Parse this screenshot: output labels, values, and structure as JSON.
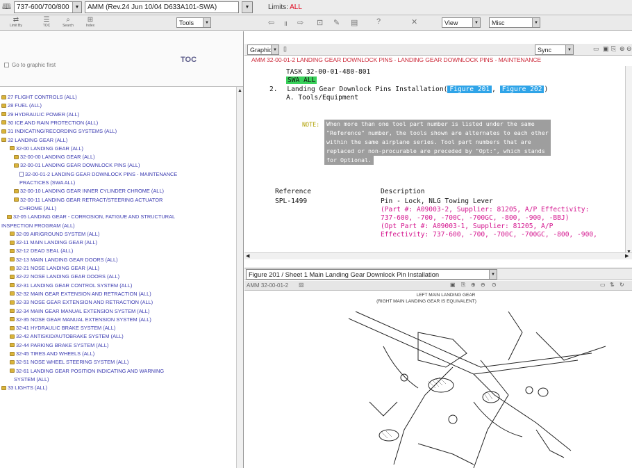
{
  "top_bar": {
    "model_select": "737-600/700/800",
    "manual_select": "AMM  (Rev.24  Jun 10/04  D633A101-SWA)",
    "limits_label": "Limits:",
    "limits_value": "ALL"
  },
  "toolbar": {
    "buttons": [
      {
        "icon": "limit-by-icon",
        "label": "Limit By"
      },
      {
        "icon": "toc-list-icon",
        "label": "TOC"
      },
      {
        "icon": "search-binoculars-icon",
        "label": "Search"
      },
      {
        "icon": "index-icon",
        "label": "Index"
      }
    ],
    "tools_select": "Tools",
    "view_select": "View",
    "misc_select": "Misc"
  },
  "toc": {
    "goto_graphic_label": "Go to graphic first",
    "title": "TOC",
    "items": [
      {
        "icon": "folder",
        "text": "27 FLIGHT CONTROLS  (ALL)"
      },
      {
        "icon": "folder",
        "text": "28 FUEL  (ALL)"
      },
      {
        "icon": "folder",
        "text": "29 HYDRAULIC POWER  (ALL)"
      },
      {
        "icon": "folder",
        "text": "30 ICE AND RAIN PROTECTION  (ALL)"
      },
      {
        "icon": "folder",
        "text": "31 INDICATING/RECORDING SYSTEMS  (ALL)"
      },
      {
        "icon": "folder-open",
        "text": "32 LANDING GEAR  (ALL)"
      },
      {
        "icon": "folder-open",
        "text": "32-00 LANDING GEAR  (ALL)"
      },
      {
        "icon": "folder",
        "text": "32-00-00 LANDING GEAR  (ALL)"
      },
      {
        "icon": "folder-open",
        "text": "32-00-01 LANDING GEAR DOWNLOCK PINS  (ALL)"
      },
      {
        "icon": "doc",
        "text": "32-00-01-2 LANDING GEAR DOWNLOCK PINS - MAINTENANCE"
      },
      {
        "icon": "none",
        "text": "PRACTICES  (SWA ALL)"
      },
      {
        "icon": "folder",
        "text": "32-00-10 LANDING GEAR INNER CYLINDER CHROME  (ALL)"
      },
      {
        "icon": "folder",
        "text": "32-00-11 LANDING GEAR RETRACT/STEERING ACTUATOR"
      },
      {
        "icon": "none",
        "text": "CHROME  (ALL)"
      },
      {
        "icon": "folder",
        "text": "32-05 LANDING GEAR - CORROSION, FATIGUE AND STRUCTURAL"
      },
      {
        "icon": "none",
        "text": "INSPECTION PROGRAM  (ALL)"
      },
      {
        "icon": "folder",
        "text": "32-09 AIR/GROUND SYSTEM  (ALL)"
      },
      {
        "icon": "folder",
        "text": "32-11 MAIN LANDING GEAR  (ALL)"
      },
      {
        "icon": "folder",
        "text": "32-12 DEAD SEAL  (ALL)"
      },
      {
        "icon": "folder",
        "text": "32-13 MAIN LANDING GEAR DOORS  (ALL)"
      },
      {
        "icon": "folder",
        "text": "32-21 NOSE LANDING GEAR  (ALL)"
      },
      {
        "icon": "folder",
        "text": "32-22 NOSE LANDING GEAR DOORS  (ALL)"
      },
      {
        "icon": "folder",
        "text": "32-31 LANDING GEAR CONTROL SYSTEM  (ALL)"
      },
      {
        "icon": "folder",
        "text": "32-32 MAIN GEAR EXTENSION AND RETRACTION  (ALL)"
      },
      {
        "icon": "folder",
        "text": "32-33 NOSE GEAR EXTENSION AND RETRACTION  (ALL)"
      },
      {
        "icon": "folder",
        "text": "32-34 MAIN GEAR MANUAL EXTENSION SYSTEM  (ALL)"
      },
      {
        "icon": "folder",
        "text": "32-35 NOSE GEAR MANUAL EXTENSION SYSTEM  (ALL)"
      },
      {
        "icon": "folder",
        "text": "32-41 HYDRAULIC BRAKE SYSTEM  (ALL)"
      },
      {
        "icon": "folder",
        "text": "32-42 ANTISKID/AUTOBRAKE SYSTEM  (ALL)"
      },
      {
        "icon": "folder",
        "text": "32-44 PARKING BRAKE SYSTEM  (ALL)"
      },
      {
        "icon": "folder",
        "text": "32-45 TIRES AND WHEELS  (ALL)"
      },
      {
        "icon": "folder",
        "text": "32-51 NOSE WHEEL STEERING SYSTEM  (ALL)"
      },
      {
        "icon": "folder",
        "text": "32-61 LANDING GEAR POSITION INDICATING AND WARNING"
      },
      {
        "icon": "none",
        "text": "SYSTEM  (ALL)"
      },
      {
        "icon": "folder",
        "text": "33 LIGHTS  (ALL)"
      }
    ]
  },
  "graphics_bar": {
    "graphics_select": "Graphics",
    "sync_select": "Sync"
  },
  "document": {
    "title_strip": "AMM 32-00-01-2 LANDING GEAR DOWNLOCK PINS - LANDING GEAR DOWNLOCK PINS - MAINTENANCE",
    "task": "TASK 32-00-01-480-801",
    "effectivity_tag": "SWA ALL",
    "step_number": "2.",
    "step_title": "Landing Gear Downlock Pins Installation(",
    "figure_link_1": "Figure 201",
    "figure_link_2": "Figure 202",
    "step_title_close": ")",
    "sub_step": "A.  Tools/Equipment",
    "note_label": "NOTE:",
    "note_lines": [
      "When more than one tool part number is listed under the same",
      "\"Reference\" number, the tools shown are alternates to each other",
      "within the same airplane series. Tool part numbers that are",
      "replaced or non-procurable are preceded by \"Opt:\", which stands",
      "for Optional."
    ],
    "table_headers": [
      "Reference",
      "Description"
    ],
    "rows": [
      {
        "reference": "SPL-1499",
        "description": "Pin - Lock, NLG Towing Lever",
        "details": [
          "(Part #: A09003-2, Supplier: 81205, A/P Effectivity:",
          "737-600, -700, -700C, -700GC, -800, -900, -BBJ)",
          "(Opt Part #: A09003-1, Supplier: 81205, A/P",
          "Effectivity: 737-600, -700, -700C, -700GC, -800, -900,"
        ]
      }
    ]
  },
  "figure_pane": {
    "figure_select": "Figure 201 / Sheet 1   Main Landing Gear Downlock Pin Installation",
    "figure_ref": "AMM 32-00-01-2",
    "caption_line_1": "LEFT MAIN LANDING GEAR",
    "caption_line_2": "(RIGHT MAIN LANDING GEAR IS EQUIVALENT)"
  },
  "colors": {
    "title_red": "#cc2a3a",
    "link_blue": "#3a3ab0",
    "effectivity_green": "#39d05a",
    "figure_link_blue": "#2fa4e8",
    "note_grey": "#9e9e9e",
    "detail_magenta": "#d4148e",
    "limits_red": "#e0001a"
  }
}
